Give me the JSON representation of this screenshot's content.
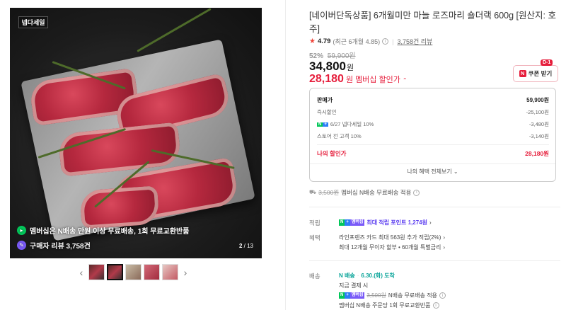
{
  "gallery": {
    "logo_badge": "넵다세일",
    "overlay_shipping": "멤버십은 N배송 만원 이상 무료배송, 1회 무료교환반품",
    "overlay_reviews": "구매자 리뷰 3,758건",
    "page_current": "2",
    "page_total": "/ 13",
    "prev_icon": "chevron-left-icon",
    "next_icon": "chevron-right-icon",
    "thumbnail_count": 5,
    "active_thumbnail": 2
  },
  "product": {
    "title": "[네이버단독상품] 6개월미만 마늘 로즈마리 숄더랙 600g [원산지: 호주]",
    "rating_score": "4.79",
    "rating_recent": "(최근 6개월 4.85)",
    "review_count": "3,758건 리뷰",
    "discount_rate": "52%",
    "original_price": "59,900원",
    "price": "34,800",
    "price_unit": "원",
    "member_price": "28,180",
    "member_price_unit": "원",
    "member_label": "멤버십 할인가",
    "member_chevron": "⌃"
  },
  "coupon": {
    "label": "쿠폰 받기",
    "n_badge": "N",
    "dday": "D-1"
  },
  "price_box": {
    "rows": [
      {
        "label": "판매가",
        "value": "59,900원"
      },
      {
        "label": "즉시할인",
        "value": "-25,100원"
      },
      {
        "label": "6/27 넵다세일 10%",
        "value": "-3,480원"
      },
      {
        "label": "스토어 전 고객 10%",
        "value": "-3,140원"
      }
    ],
    "total_label": "나의 할인가",
    "total_value": "28,180원",
    "more_label": "나의 혜택 전체보기 ⌄"
  },
  "shipping_free": {
    "strike_price": "3,500원",
    "text": "멤버십 N배송 무료배송 적용"
  },
  "points": {
    "label": "적립",
    "text": "최대 적립 포인트 1,274원",
    "chevron": "›"
  },
  "benefits": {
    "label": "혜택",
    "line1": "라인프렌즈 카드 최대 563원 추가 적립(2%)",
    "line2": "최대 12개월 무이자 할부 • 60개월 특별금리",
    "chevron": "›"
  },
  "delivery": {
    "label": "배송",
    "badge": "N 배송",
    "arrival": "6.30.(화) 도착",
    "line1": "지금 결제 시",
    "strike_price": "3,500원",
    "line2_suffix": "N배송 무료배송 적용",
    "line3": "멤버십 N배송 주문당 1회 무료교환반품"
  },
  "colors": {
    "brand_red": "#e61e3c",
    "naver_green": "#03c75a",
    "plus_blue": "#2d7ef7",
    "points_purple": "#5b3df0"
  }
}
